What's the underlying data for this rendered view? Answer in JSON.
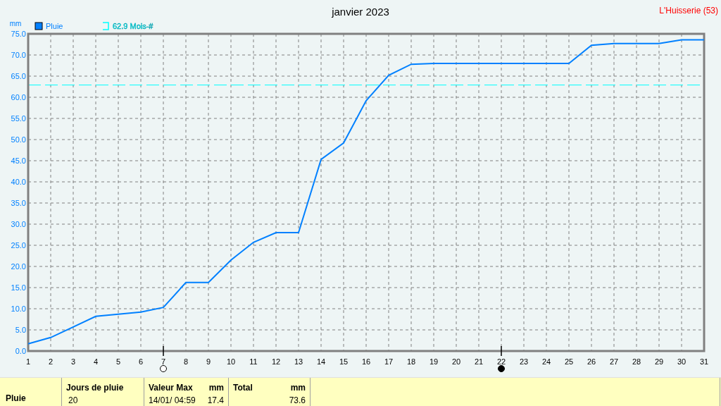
{
  "title": "janvier 2023",
  "location": {
    "name": "L'Huisserie",
    "code": "(53)"
  },
  "chart": {
    "chart_data": {
      "type": "line",
      "ylabel": "mm",
      "x": [
        1,
        2,
        3,
        4,
        5,
        6,
        7,
        8,
        9,
        10,
        11,
        12,
        13,
        14,
        15,
        16,
        17,
        18,
        19,
        20,
        21,
        22,
        23,
        24,
        25,
        26,
        27,
        28,
        29,
        30,
        31
      ],
      "series": [
        {
          "name": "Pluie",
          "color": "#0080ff",
          "values": [
            1.7,
            3.2,
            5.7,
            8.2,
            8.7,
            9.2,
            10.3,
            16.2,
            16.2,
            21.5,
            25.7,
            28.0,
            28.0,
            45.3,
            49.2,
            59.2,
            65.2,
            67.8,
            68.0,
            68.0,
            68.0,
            68.0,
            68.0,
            68.0,
            68.0,
            72.3,
            72.7,
            72.7,
            72.7,
            73.6,
            73.6
          ]
        }
      ],
      "xlim": [
        1,
        31
      ],
      "ylim": [
        0,
        75
      ],
      "xticks": [
        1,
        2,
        3,
        4,
        5,
        6,
        7,
        8,
        9,
        10,
        11,
        12,
        13,
        14,
        15,
        16,
        17,
        18,
        19,
        20,
        21,
        22,
        23,
        24,
        25,
        26,
        27,
        28,
        29,
        30,
        31
      ],
      "yticks": [
        {
          "value": 0,
          "label": "0.0"
        },
        {
          "value": 5,
          "label": "5.0"
        },
        {
          "value": 10,
          "label": "10.0"
        },
        {
          "value": 15,
          "label": "15.0"
        },
        {
          "value": 20,
          "label": "20.0"
        },
        {
          "value": 25,
          "label": "25.0"
        },
        {
          "value": 30,
          "label": "30.0"
        },
        {
          "value": 35,
          "label": "35.0"
        },
        {
          "value": 40,
          "label": "40.0"
        },
        {
          "value": 45,
          "label": "45.0"
        },
        {
          "value": 50,
          "label": "50.0"
        },
        {
          "value": 55,
          "label": "55.0"
        },
        {
          "value": 60,
          "label": "60.0"
        },
        {
          "value": 65,
          "label": "65.0"
        },
        {
          "value": 70,
          "label": "70.0"
        },
        {
          "value": 75,
          "label": "75.0"
        }
      ],
      "grid": true,
      "legend": "top left",
      "ref_lines": [
        {
          "axis": "y",
          "value": 62.9,
          "label": "62.9 Mois-#",
          "color": "#00ffff"
        }
      ]
    },
    "moon_phases": [
      {
        "day": "7",
        "filled": false
      },
      {
        "day": "22",
        "filled": true
      }
    ]
  },
  "summary": {
    "row_label": "Pluie",
    "groups": [
      {
        "title": "Jours de pluie",
        "values": [
          "20"
        ]
      },
      {
        "title": "Valeur Max",
        "unit": "mm",
        "values": [
          "14/01/ 04:59",
          "17.4"
        ]
      },
      {
        "title": "Total",
        "unit": "mm",
        "values": [
          "73.6"
        ]
      }
    ]
  }
}
